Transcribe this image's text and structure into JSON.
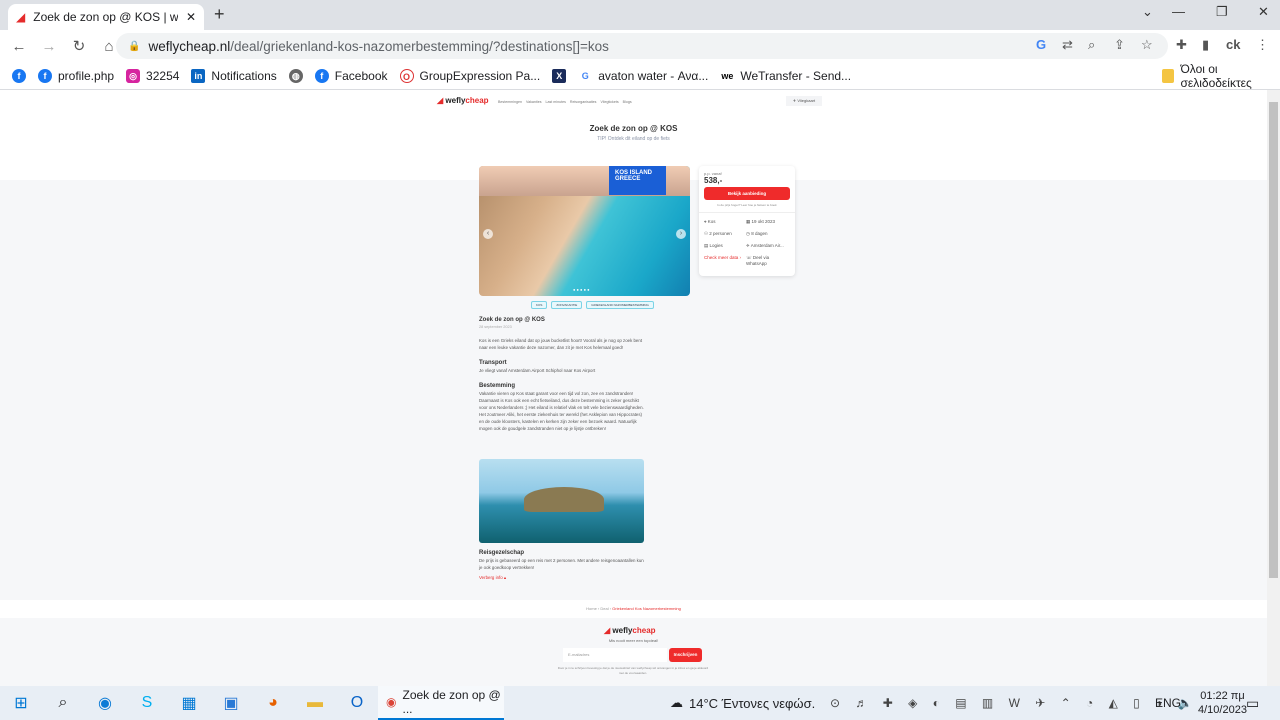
{
  "browser": {
    "tab_title": "Zoek de zon op @ KOS | weflych",
    "url_host": "weflycheap.nl",
    "url_path": "/deal/griekenland-kos-nazomerbestemming/?destinations[]=kos",
    "bookmarks": [
      "profile.php",
      "32254",
      "Notifications",
      "Facebook",
      "GroupExpression Pa...",
      "avaton water - Ανα...",
      "WeTransfer - Send..."
    ],
    "all_bookmarks": "Όλοι οι σελιδοδείκτες"
  },
  "site": {
    "logo_a": "wefly",
    "logo_b": "cheap",
    "nav": [
      "Bestemmingen",
      "Vakanties",
      "Last minutes",
      "Reisorganisaties",
      "Vliegtickets",
      "Blogs"
    ],
    "vliegkaart": "Vliegkaart",
    "title": "Zoek de zon op @ KOS",
    "subtitle": "TIP! Ontdek dit eiland op de fiets",
    "badge": "KOS ISLAND GREECE",
    "card": {
      "pp_label": "p.p. vanaf",
      "price": "538,-",
      "cta": "Bekijk aanbieding",
      "note": "Is de prijs hoger? Leer hoe je fietsen te boek",
      "destination": "Kos",
      "date": "19 okt 2023",
      "persons": "2 personen",
      "duration": "8 dagen",
      "board": "Logies",
      "airport": "Amsterdam Air...",
      "more_dates": "Check meer data",
      "whatsapp": "Deel via WhatsApp"
    },
    "tags": [
      "KOS",
      "ZONVAKANTIE",
      "GRIEKENLAND NAZOMERBESTEMMING"
    ],
    "article": {
      "title": "Zoek de zon op @ KOS",
      "date": "28 september 2023",
      "intro": "Kos is een Grieks eiland dat op jouw bucketlist hoort! Vooral als je nog op zoek bent naar een leuke vakantie deze nazomer, dan zit je met Kos helemaal goed!",
      "h_transport": "Transport",
      "transport": "Je vliegt vanaf Amsterdam Airport Schiphol naar Kos Airport",
      "h_dest": "Bestemming",
      "dest": "Vakantie vieren op Kos staat garant voor een tijd vol zon, zee en zandstranden! Daarnaast is Kos ook een echt fietseiland, dus deze bestemming is zeker geschikt voor ons Nederlanders ;) Het eiland is relatief vlak en telt vele bezienswaardigheden. Het zoutmeer Aliki, het eerste ziekenhuis ter wereld (het Asklepion van Hippocrates) en de oude kloosters, kastelen en kerken zijn zeker een bezoek waard. Natuurlijk mogen ook de goudgele zandstranden niet op je lijstje ontbreken!",
      "h_travel": "Reisgezelschap",
      "travel": "De prijs is gebaseerd op een reis met 2 personen. Met andere reisgenoaantallen kun je ook goedkoop vertrekken!",
      "hide": "Verberg info ▴"
    },
    "breadcrumb": [
      "Home",
      "Deal",
      "Griekenland Kos Nazomerbestemming"
    ],
    "footer": {
      "tagline": "Mis nooit meer een topdeal!",
      "email_placeholder": "E-mailadres",
      "subscribe": "Inschrijven",
      "legal": "Door je in te schrijven bevestig je dat je de nieuwsbrief van weflycheap wil ontvangen in je inbox en ga je akkoord met de voorwaarden."
    }
  },
  "taskbar": {
    "app": "Zoek de zon op @ ...",
    "weather": "14°C  Έντονες νεφώσ.",
    "lang": "ENG",
    "time": "01:22 πμ",
    "date": "4/10/2023"
  }
}
